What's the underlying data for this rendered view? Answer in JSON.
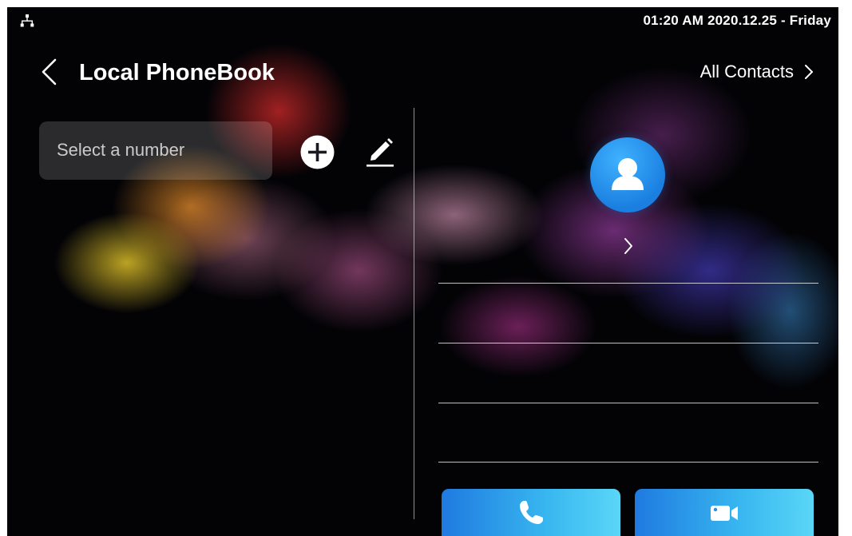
{
  "status_bar": {
    "network_icon": "network-topology-icon",
    "datetime": "01:20 AM  2020.12.25 - Friday"
  },
  "header": {
    "back_icon": "chevron-left-icon",
    "title": "Local PhoneBook",
    "all_contacts_label": "All Contacts",
    "all_contacts_icon": "chevron-right-icon"
  },
  "left_panel": {
    "select_placeholder": "Select a number",
    "add_icon": "plus-circle-icon",
    "edit_icon": "pencil-icon"
  },
  "contact_detail": {
    "avatar_icon": "user-icon",
    "name_arrow_icon": "chevron-right-icon",
    "fields": [
      "",
      "",
      "",
      ""
    ]
  },
  "actions": {
    "audio_call_icon": "phone-icon",
    "video_call_icon": "video-camera-icon"
  },
  "colors": {
    "screen_background": "#030306",
    "accent_blue": "#1f7ae0",
    "accent_cyan": "#5ad6f7",
    "avatar_blue": "#2a96f0",
    "text": "#ffffff"
  }
}
